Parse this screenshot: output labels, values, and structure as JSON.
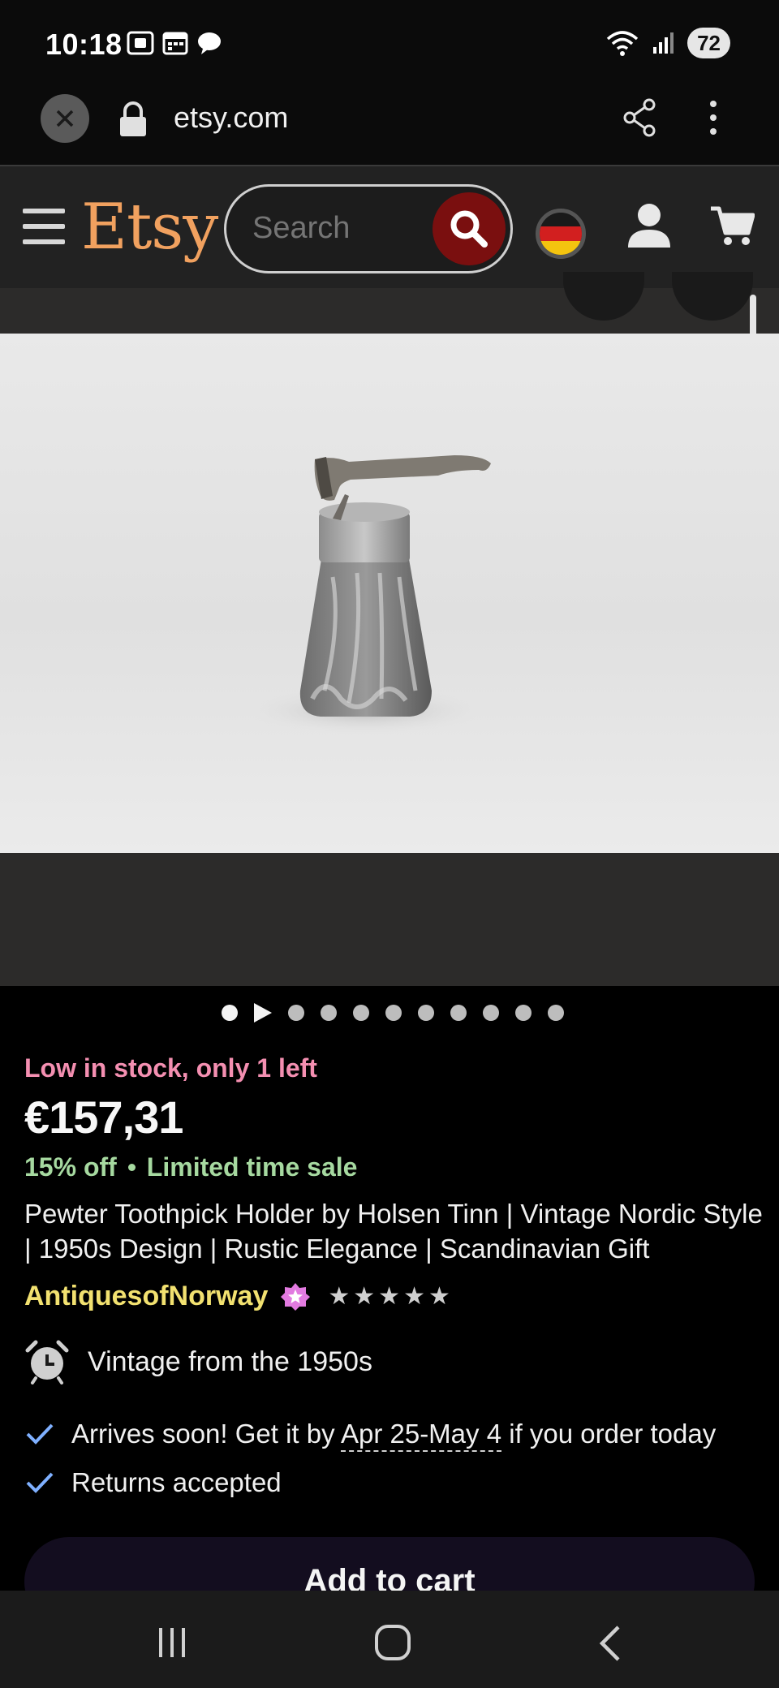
{
  "status_bar": {
    "time": "10:18",
    "battery": "72"
  },
  "browser": {
    "url": "etsy.com"
  },
  "header": {
    "logo": "Etsy",
    "search_placeholder": "Search"
  },
  "gallery": {
    "image_alt": "Pewter toothpick holder with axe",
    "dot_count": 11,
    "active_index": 0
  },
  "listing": {
    "stock": "Low in stock, only 1 left",
    "price": "€157,31",
    "discount": "15% off",
    "sale": "Limited time sale",
    "title": "Pewter Toothpick Holder by Holsen Tinn | Vintage Nordic Style | 1950s Design | Rustic Elegance | Scandinavian Gift",
    "shop_name": "AntiquesofNorway",
    "rating_stars": 5,
    "vintage": "Vintage from the 1950s",
    "arrives_prefix": "Arrives soon! Get it by ",
    "arrives_dates": "Apr 25-May 4",
    "arrives_suffix": " if you order today",
    "returns": "Returns accepted",
    "add_to_cart": "Add to cart"
  },
  "colors": {
    "logo": "#f1a15f",
    "stock": "#f48fb1",
    "sale": "#a6d9a0",
    "shop": "#f2e170",
    "star_seller_badge": "#e27ae0",
    "search_button": "#7a0f0f"
  }
}
